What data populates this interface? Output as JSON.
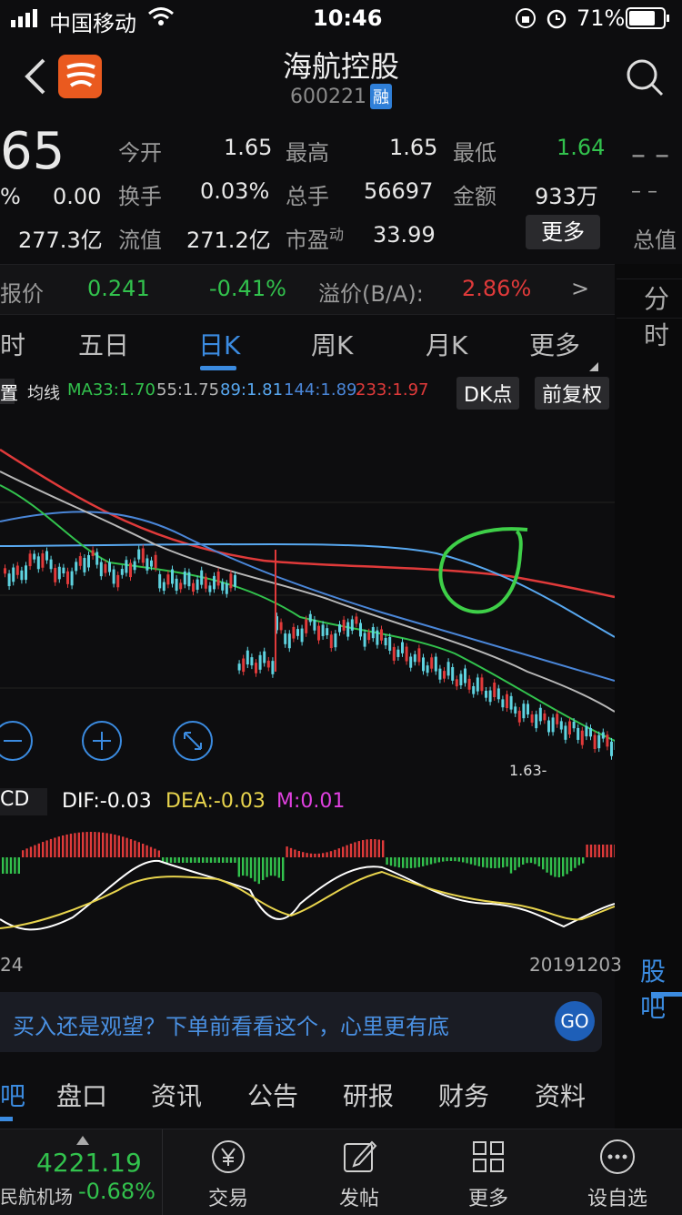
{
  "status": {
    "carrier": "中国移动",
    "time": "10:46",
    "battery": "71%"
  },
  "header": {
    "title": "海航控股",
    "code": "600221",
    "badge": "融"
  },
  "price": {
    "current": "65",
    "pct": "%",
    "change": "0.00",
    "mktcap": "277.3亿"
  },
  "quote": {
    "open_label": "今开",
    "open": "1.65",
    "high_label": "最高",
    "high": "1.65",
    "low_label": "最低",
    "low": "1.64",
    "turnover_label": "换手",
    "turnover": "0.03%",
    "volume_label": "总手",
    "volume": "56697",
    "amount_label": "金额",
    "amount": "933万",
    "float_label": "流值",
    "float": "271.2亿",
    "pe_label": "市盈",
    "pe_sup": "动",
    "pe": "33.99",
    "more_label": "更多",
    "right_dash": "– –",
    "right_dash2": "– –",
    "right_total": "总值"
  },
  "hk": {
    "label": "报价",
    "price": "0.241",
    "pct": "-0.41%",
    "premium_label": "溢价(B/A):",
    "premium": "2.86%",
    "arrow": ">"
  },
  "right_panel": {
    "top": "分时",
    "bottom": "股吧"
  },
  "tabs": [
    {
      "label": "时"
    },
    {
      "label": "五日"
    },
    {
      "label": "日K"
    },
    {
      "label": "周K"
    },
    {
      "label": "月K"
    },
    {
      "label": "更多"
    }
  ],
  "ma": {
    "left": "置",
    "label": "均线",
    "ma33": "MA33:1.70",
    "ma55": "55:1.75",
    "ma89": "89:1.81",
    "ma144": "144:1.89",
    "ma233": "233:1.97",
    "dk": "DK点",
    "fq": "前复权"
  },
  "chart": {
    "low_marker": "1.63-",
    "date_left": "24",
    "date_right": "20191203"
  },
  "macd": {
    "label": "CD",
    "dif": "DIF:-0.03",
    "dea": "DEA:-0.03",
    "m": "M:0.01"
  },
  "banner": {
    "text": "买入还是观望？下单前看看这个，心里更有底",
    "go": "GO"
  },
  "bottom_tabs": [
    "吧",
    "盘口",
    "资讯",
    "公告",
    "研报",
    "财务",
    "资料"
  ],
  "footer": {
    "index_value": "4221.19",
    "index_name": "民航机场",
    "index_pct": "-0.68%",
    "items": [
      "交易",
      "发帖",
      "更多",
      "设自选"
    ]
  },
  "colors": {
    "green": "#32c24d",
    "red": "#e03a3a",
    "blue": "#3b8be0"
  }
}
